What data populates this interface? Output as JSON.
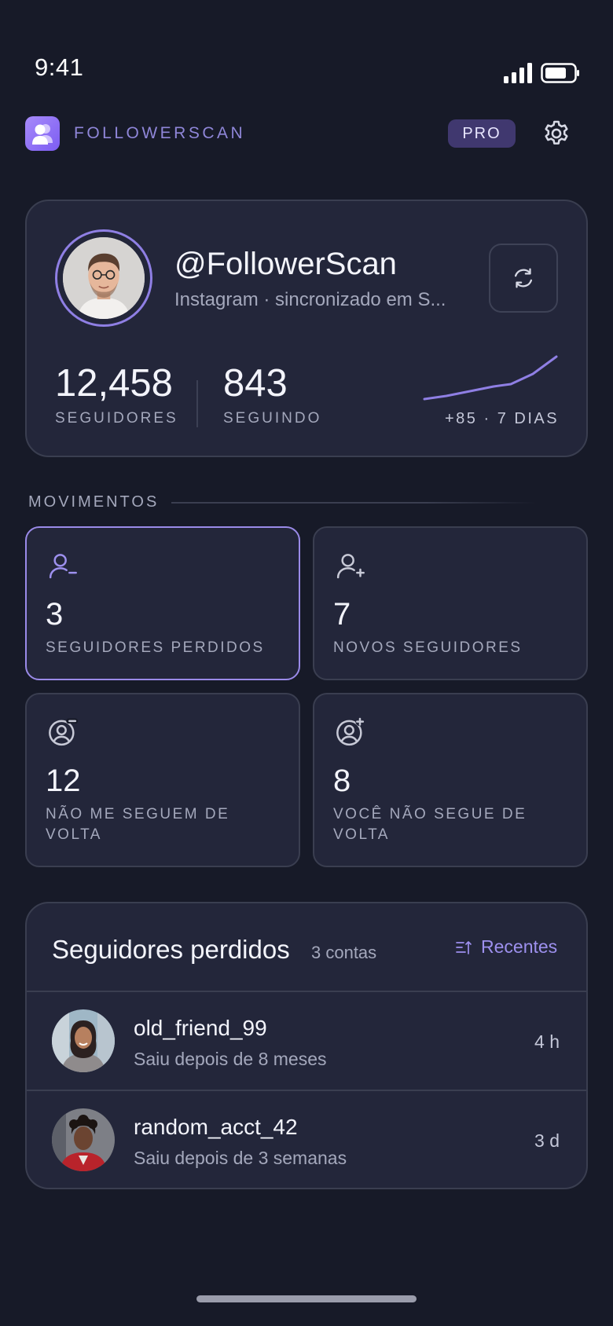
{
  "status_bar": {
    "time": "9:41"
  },
  "header": {
    "app_name": "FOLLOWERSCAN",
    "badge": "PRO",
    "logo_icon": "users-icon",
    "settings_icon": "gear-icon"
  },
  "profile": {
    "handle": "@FollowerScan",
    "subtitle": "Instagram · sincronizado em S...",
    "followers_value": "12,458",
    "followers_label": "SEGUIDORES",
    "following_value": "843",
    "following_label": "SEGUINDO",
    "trend_text": "+85 · 7 DIAS",
    "trend_color": "#8f7fe4"
  },
  "movements": {
    "label": "MOVIMENTOS",
    "tiles": [
      {
        "icon": "user-minus-icon",
        "value": "3",
        "label": "SEGUIDORES PERDIDOS",
        "active": true
      },
      {
        "icon": "user-plus-icon",
        "value": "7",
        "label": "NOVOS SEGUIDORES",
        "active": false
      },
      {
        "icon": "user-circle-minus-icon",
        "value": "12",
        "label": "NÃO ME SEGUEM DE VOLTA",
        "active": false
      },
      {
        "icon": "user-circle-plus-icon",
        "value": "8",
        "label": "VOCÊ NÃO SEGUE DE VOLTA",
        "active": false
      }
    ]
  },
  "lost_list": {
    "title": "Seguidores perdidos",
    "count": "3 contas",
    "sort_label": "Recentes",
    "rows": [
      {
        "name": "old_friend_99",
        "detail": "Saiu depois de 8 meses",
        "time": "4 h"
      },
      {
        "name": "random_acct_42",
        "detail": "Saiu depois de 3 semanas",
        "time": "3 d"
      }
    ]
  },
  "colors": {
    "accent": "#8f7fe4",
    "background": "#171a28",
    "card": "#23263a"
  }
}
